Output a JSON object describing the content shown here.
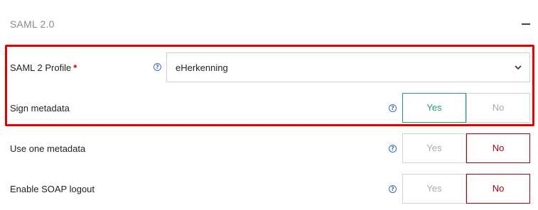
{
  "section": {
    "title": "SAML 2.0",
    "collapse_icon": "minus-icon"
  },
  "fields": [
    {
      "label": "SAML 2 Profile",
      "required_mark": "*",
      "help": "?",
      "value": "eHerkenning"
    },
    {
      "label": "Sign metadata",
      "help": "?",
      "yes": "Yes",
      "no": "No",
      "selected": "Yes"
    },
    {
      "label": "Use one metadata",
      "help": "?",
      "yes": "Yes",
      "no": "No",
      "selected": "No"
    },
    {
      "label": "Enable SOAP logout",
      "help": "?",
      "yes": "Yes",
      "no": "No",
      "selected": "No"
    }
  ],
  "colors": {
    "yes_active": "#1f9a77",
    "no_active": "#a00010",
    "highlight": "#e00000"
  }
}
